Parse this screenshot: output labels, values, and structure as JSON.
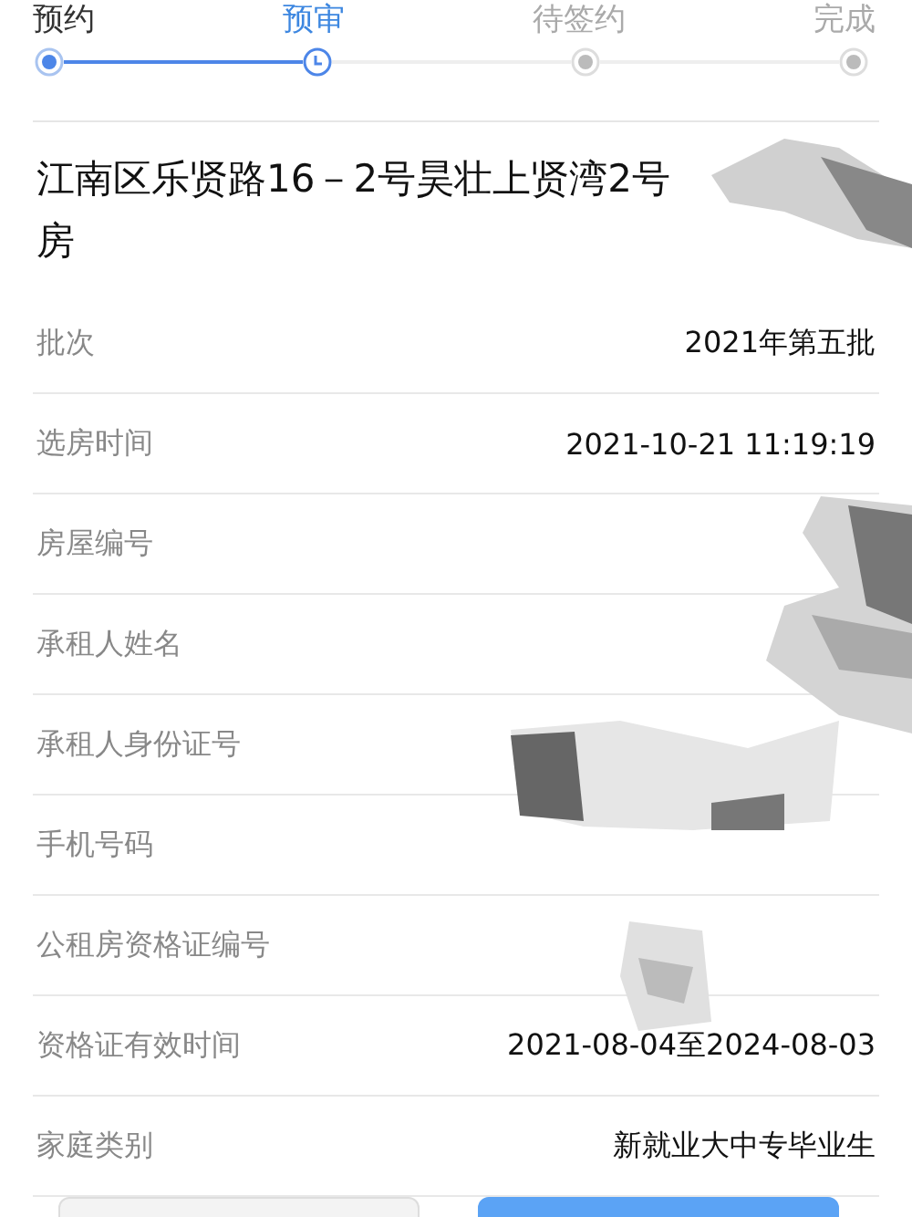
{
  "steps": [
    {
      "label": "预约",
      "completed": true,
      "selected": false
    },
    {
      "label": "预审",
      "completed": false,
      "selected": true
    },
    {
      "label": "待签约",
      "completed": false,
      "selected": false
    },
    {
      "label": "完成",
      "completed": false,
      "selected": false
    }
  ],
  "title_lines": [
    "江南区乐贤路16－2号昊壮上贤湾2号",
    "房"
  ],
  "rows": [
    {
      "label": "批次",
      "value": "2021年第五批"
    },
    {
      "label": "选房时间",
      "value": "2021-10-21 11:19:19"
    },
    {
      "label": "房屋编号"
    },
    {
      "label": "承租人姓名"
    },
    {
      "label": "承租人身份证号"
    },
    {
      "label": "手机号码"
    },
    {
      "label": "公租房资格证编号"
    },
    {
      "label": "资格证有效时间",
      "value": "2021-08-04至2024-08-03"
    },
    {
      "label": "家庭类别",
      "value": "新就业大中专毕业生"
    }
  ],
  "buttons": [
    {
      "kind": "secondary"
    },
    {
      "kind": "primary"
    }
  ]
}
